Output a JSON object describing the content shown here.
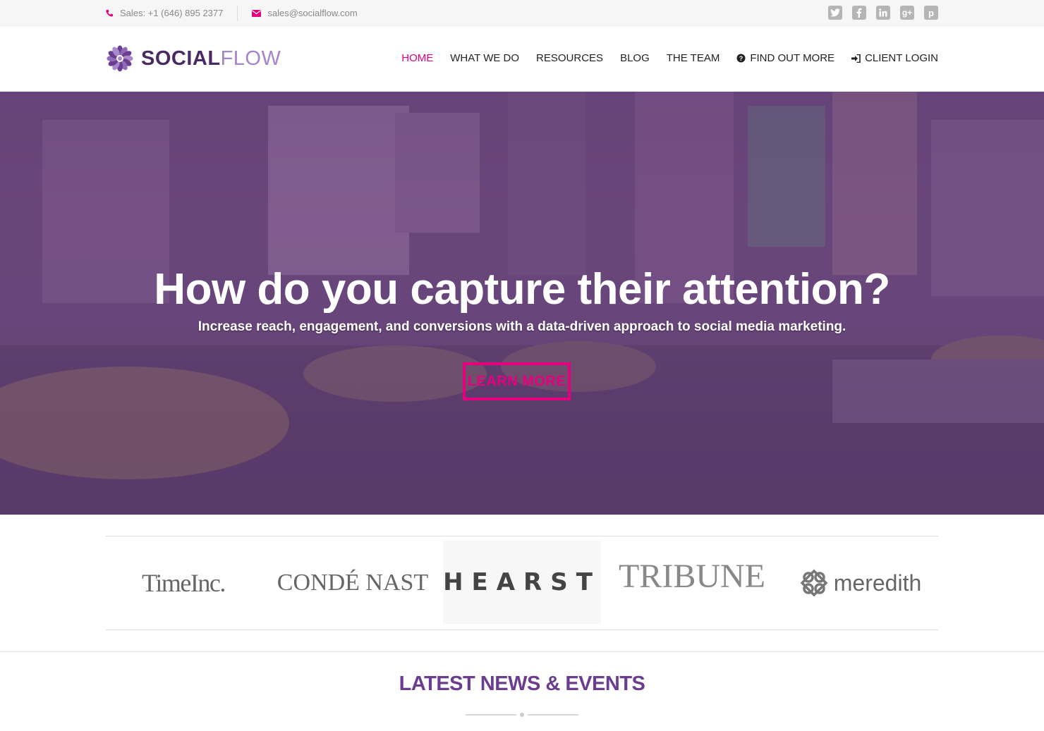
{
  "topbar": {
    "phone": "Sales: +1 (646) 895 2377",
    "email": "sales@socialflow.com",
    "social_icons": [
      "twitter-icon",
      "facebook-icon",
      "linkedin-icon",
      "google-plus-icon",
      "pinterest-icon"
    ]
  },
  "logo": {
    "part1": "SOCIAL",
    "part2": "FLOW"
  },
  "nav": {
    "home": "HOME",
    "what_we_do": "WHAT WE DO",
    "resources": "RESOURCES",
    "blog": "BLOG",
    "team": "THE TEAM",
    "find_out_more": "FIND OUT MORE",
    "client_login": "CLIENT LOGIN"
  },
  "hero": {
    "headline": "How do you capture their attention?",
    "subhead": "Increase reach, engagement, and conversions with a data-driven approach to social media marketing.",
    "cta": "LEARN MORE"
  },
  "clients": {
    "c1": "TimeInc.",
    "c2": "CONDÉ NAST",
    "c3": "HEARST",
    "c4": "TRIBUNE",
    "c5": "meredith"
  },
  "news": {
    "title": "LATEST NEWS & EVENTS"
  },
  "colors": {
    "accent": "#e6007e",
    "brand_purple": "#6b3d91",
    "hero_overlay": "#5c3670"
  }
}
